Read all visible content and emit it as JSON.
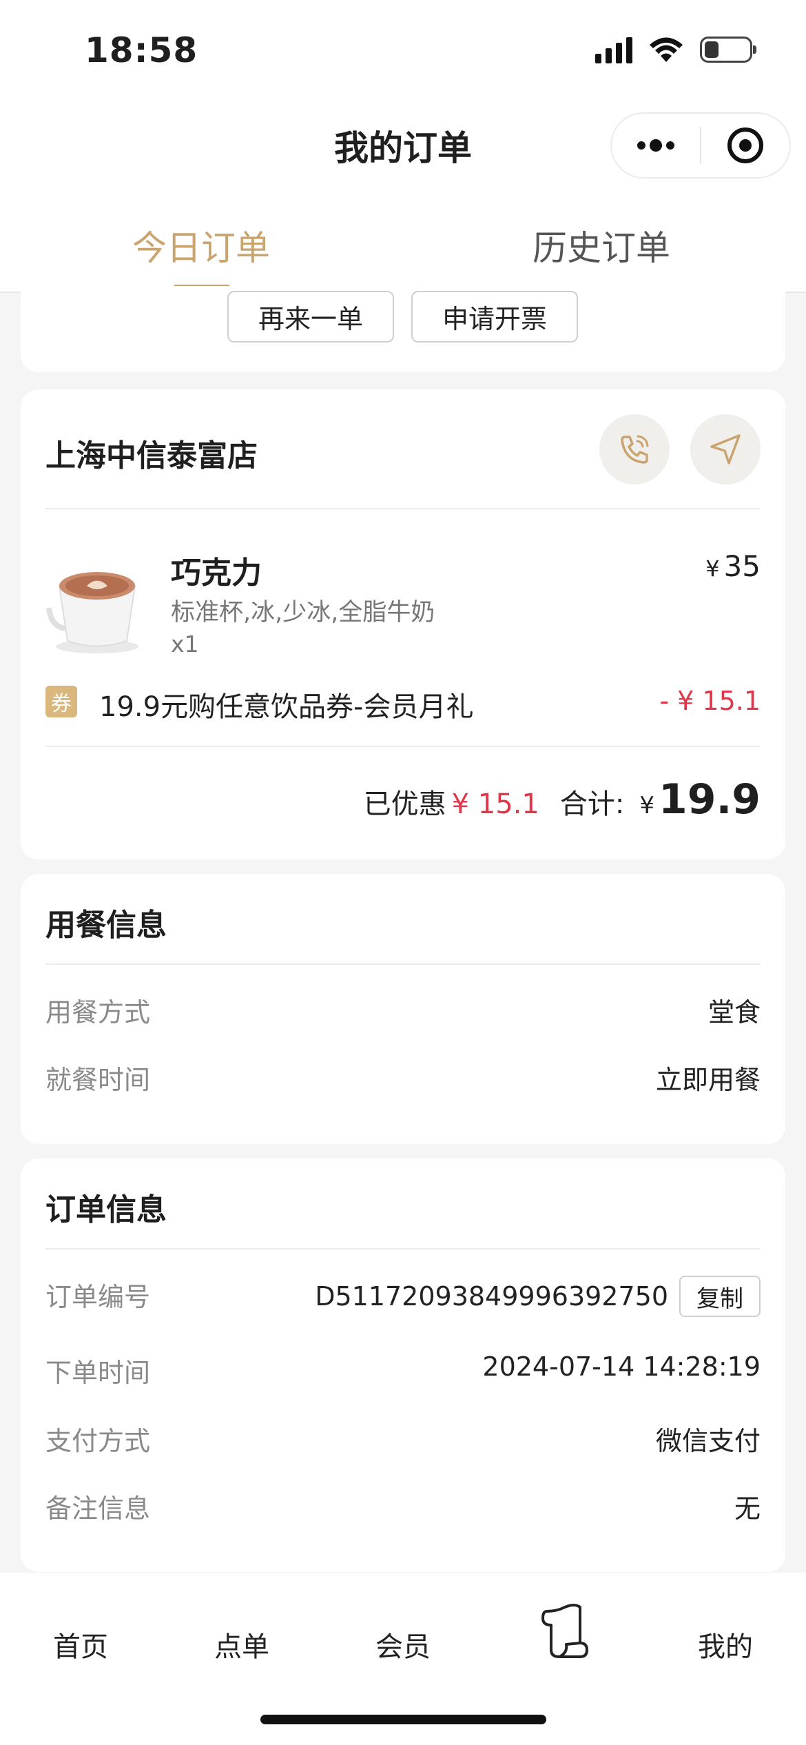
{
  "status_bar": {
    "time": "18:58"
  },
  "header": {
    "title": "我的订单"
  },
  "tabs": [
    {
      "label": "今日订单",
      "active": true
    },
    {
      "label": "历史订单",
      "active": false
    }
  ],
  "prev_order_actions": {
    "reorder": "再来一单",
    "invoice": "申请开票"
  },
  "order": {
    "store": "上海中信泰富店",
    "item": {
      "name": "巧克力",
      "spec": "标准杯,冰,少冰,全脂牛奶",
      "qty": "x1",
      "currency": "¥",
      "price": "35"
    },
    "coupon": {
      "badge": "券",
      "name": "19.9元购任意饮品券-会员月礼",
      "amount": "- ¥ 15.1"
    },
    "summary": {
      "discount_label": "已优惠",
      "discount": "¥ 15.1",
      "total_label": "合计:",
      "currency": "¥",
      "total": "19.9"
    }
  },
  "dining": {
    "title": "用餐信息",
    "rows": [
      {
        "label": "用餐方式",
        "value": "堂食"
      },
      {
        "label": "就餐时间",
        "value": "立即用餐"
      }
    ]
  },
  "order_info": {
    "title": "订单信息",
    "order_no_label": "订单编号",
    "order_no": "D5117209384999639275​0",
    "copy_label": "复制",
    "rows": [
      {
        "label": "下单时间",
        "value": "2024-07-14 14:28:19"
      },
      {
        "label": "支付方式",
        "value": "微信支付"
      },
      {
        "label": "备注信息",
        "value": "无"
      }
    ]
  },
  "tabbar": [
    "首页",
    "点单",
    "会员",
    "我的"
  ],
  "colors": {
    "accent": "#c9a46e",
    "discount": "#e0364a"
  }
}
